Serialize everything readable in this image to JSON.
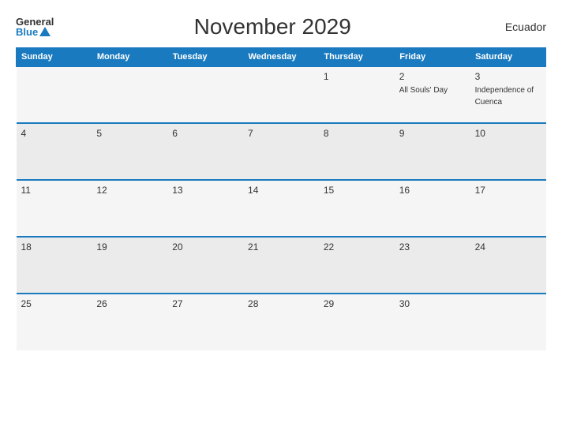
{
  "header": {
    "logo_general": "General",
    "logo_blue": "Blue",
    "title": "November 2029",
    "country": "Ecuador"
  },
  "days_of_week": [
    "Sunday",
    "Monday",
    "Tuesday",
    "Wednesday",
    "Thursday",
    "Friday",
    "Saturday"
  ],
  "weeks": [
    [
      {
        "day": "",
        "events": []
      },
      {
        "day": "",
        "events": []
      },
      {
        "day": "",
        "events": []
      },
      {
        "day": "",
        "events": []
      },
      {
        "day": "1",
        "events": []
      },
      {
        "day": "2",
        "events": [
          "All Souls' Day"
        ]
      },
      {
        "day": "3",
        "events": [
          "Independence of Cuenca"
        ]
      }
    ],
    [
      {
        "day": "4",
        "events": []
      },
      {
        "day": "5",
        "events": []
      },
      {
        "day": "6",
        "events": []
      },
      {
        "day": "7",
        "events": []
      },
      {
        "day": "8",
        "events": []
      },
      {
        "day": "9",
        "events": []
      },
      {
        "day": "10",
        "events": []
      }
    ],
    [
      {
        "day": "11",
        "events": []
      },
      {
        "day": "12",
        "events": []
      },
      {
        "day": "13",
        "events": []
      },
      {
        "day": "14",
        "events": []
      },
      {
        "day": "15",
        "events": []
      },
      {
        "day": "16",
        "events": []
      },
      {
        "day": "17",
        "events": []
      }
    ],
    [
      {
        "day": "18",
        "events": []
      },
      {
        "day": "19",
        "events": []
      },
      {
        "day": "20",
        "events": []
      },
      {
        "day": "21",
        "events": []
      },
      {
        "day": "22",
        "events": []
      },
      {
        "day": "23",
        "events": []
      },
      {
        "day": "24",
        "events": []
      }
    ],
    [
      {
        "day": "25",
        "events": []
      },
      {
        "day": "26",
        "events": []
      },
      {
        "day": "27",
        "events": []
      },
      {
        "day": "28",
        "events": []
      },
      {
        "day": "29",
        "events": []
      },
      {
        "day": "30",
        "events": []
      },
      {
        "day": "",
        "events": []
      }
    ]
  ]
}
